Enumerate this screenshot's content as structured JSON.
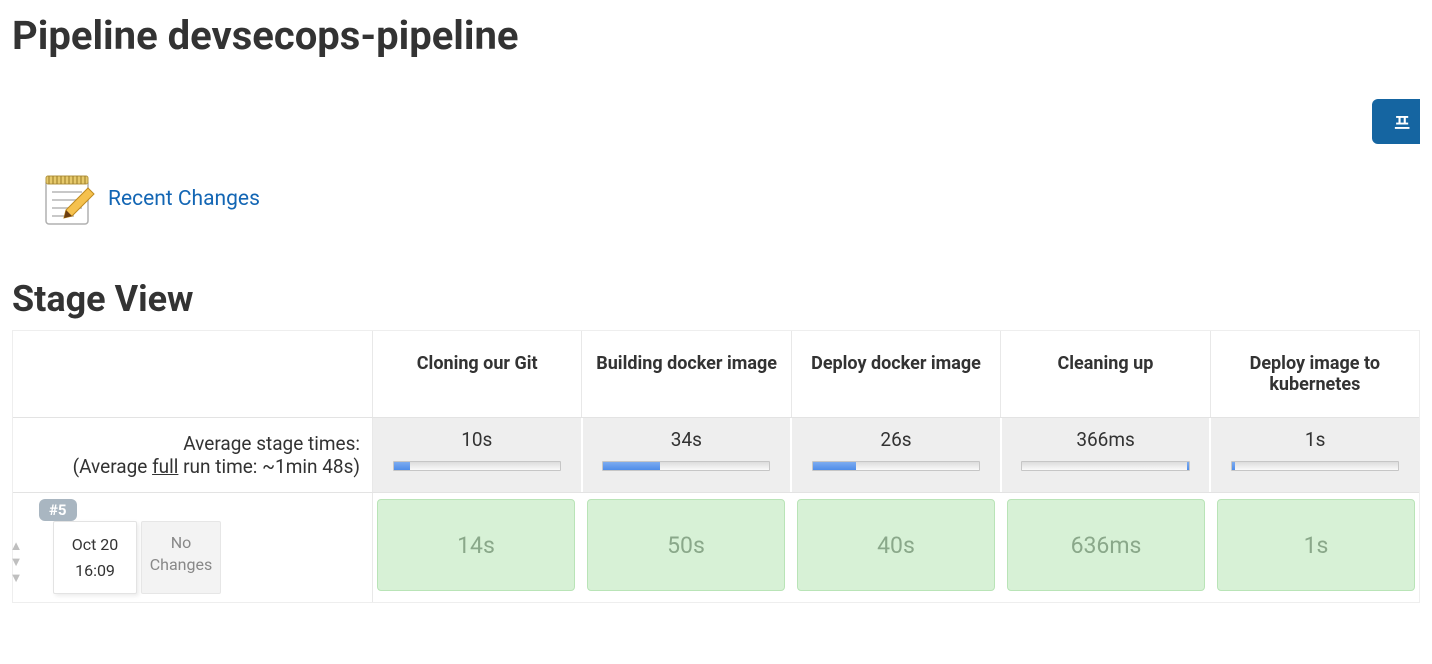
{
  "page_title": "Pipeline devsecops-pipeline",
  "header_button_label": "프",
  "recent_changes_label": "Recent Changes",
  "stage_view_heading": "Stage View",
  "stages": [
    "Cloning our Git",
    "Building docker image",
    "Deploy docker image",
    "Cleaning up",
    "Deploy image to kubernetes"
  ],
  "average": {
    "line1": "Average stage times:",
    "line2_prefix": "(Average ",
    "line2_full_word": "full",
    "line2_suffix": " run time: ~1min 48s)",
    "times": [
      "10s",
      "34s",
      "26s",
      "366ms",
      "1s"
    ],
    "bar_pct": [
      10,
      34,
      26,
      1,
      2
    ]
  },
  "run": {
    "badge": "#5",
    "date": "Oct 20",
    "time": "16:09",
    "changes_line1": "No",
    "changes_line2": "Changes",
    "times": [
      "14s",
      "50s",
      "40s",
      "636ms",
      "1s"
    ]
  }
}
